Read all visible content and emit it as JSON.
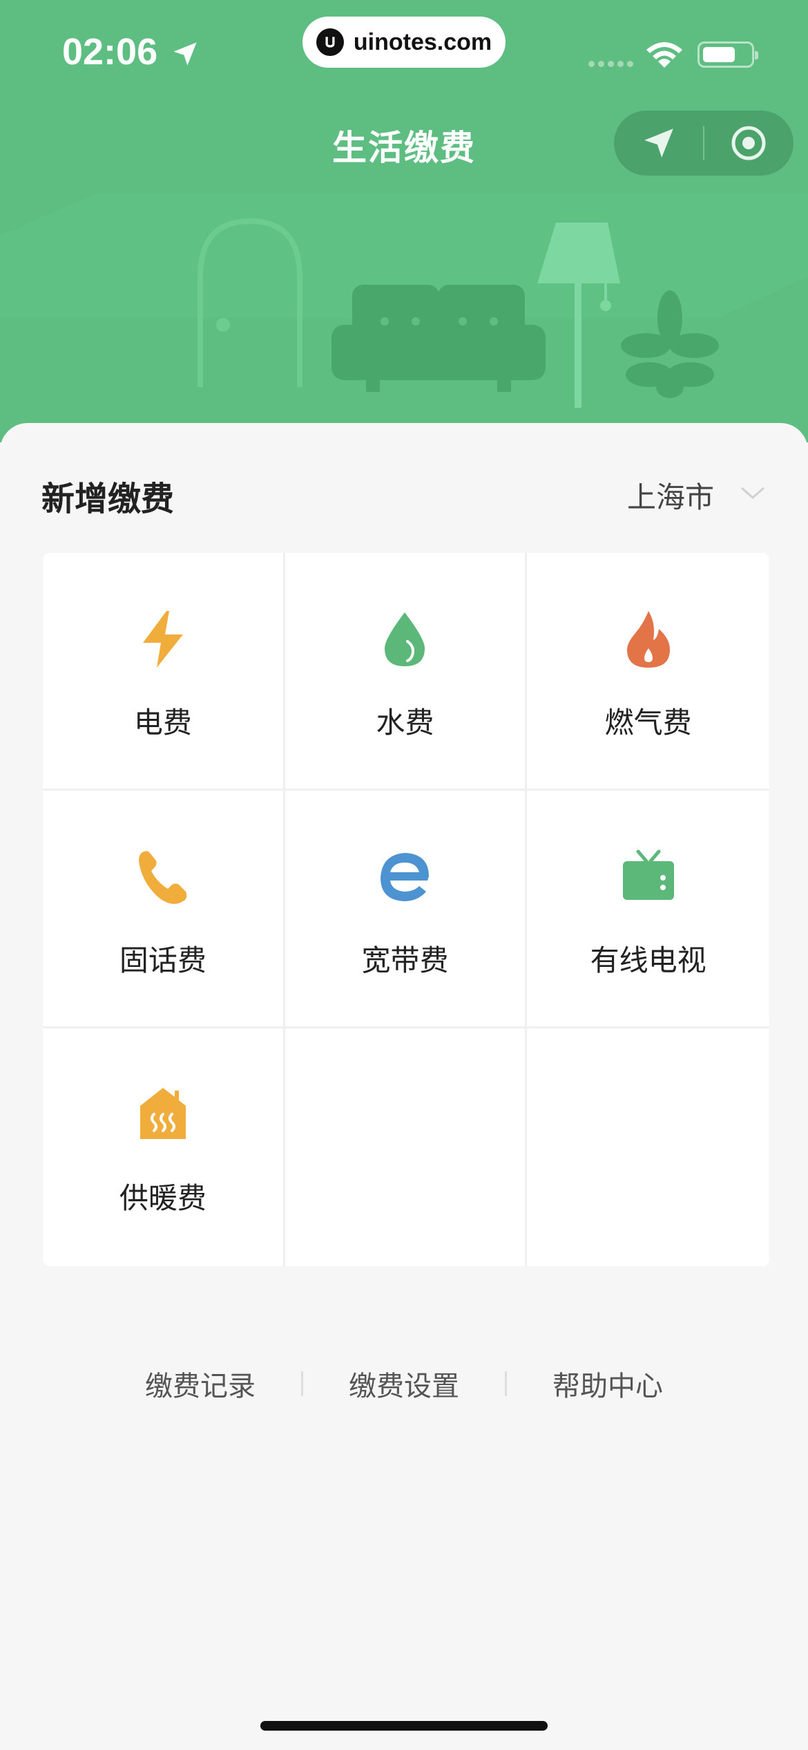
{
  "status_bar": {
    "time": "02:06",
    "battery_level": 0.7
  },
  "watermark": {
    "text": "uinotes.com"
  },
  "header": {
    "title": "生活缴费"
  },
  "section": {
    "title": "新增缴费",
    "city": "上海市"
  },
  "services": [
    {
      "label": "电费",
      "icon": "lightning-icon",
      "color": "#f0ad3c"
    },
    {
      "label": "水费",
      "icon": "water-drop-icon",
      "color": "#5cb878"
    },
    {
      "label": "燃气费",
      "icon": "flame-icon",
      "color": "#e27448"
    },
    {
      "label": "固话费",
      "icon": "phone-icon",
      "color": "#f0ad3c"
    },
    {
      "label": "宽带费",
      "icon": "broadband-icon",
      "color": "#4d93d1"
    },
    {
      "label": "有线电视",
      "icon": "tv-icon",
      "color": "#5cb878"
    },
    {
      "label": "供暖费",
      "icon": "heating-icon",
      "color": "#f0ad3c"
    }
  ],
  "footer": {
    "links": [
      "缴费记录",
      "缴费设置",
      "帮助中心"
    ]
  },
  "colors": {
    "brand_green": "#5ebe82",
    "background": "#f6f6f6"
  }
}
